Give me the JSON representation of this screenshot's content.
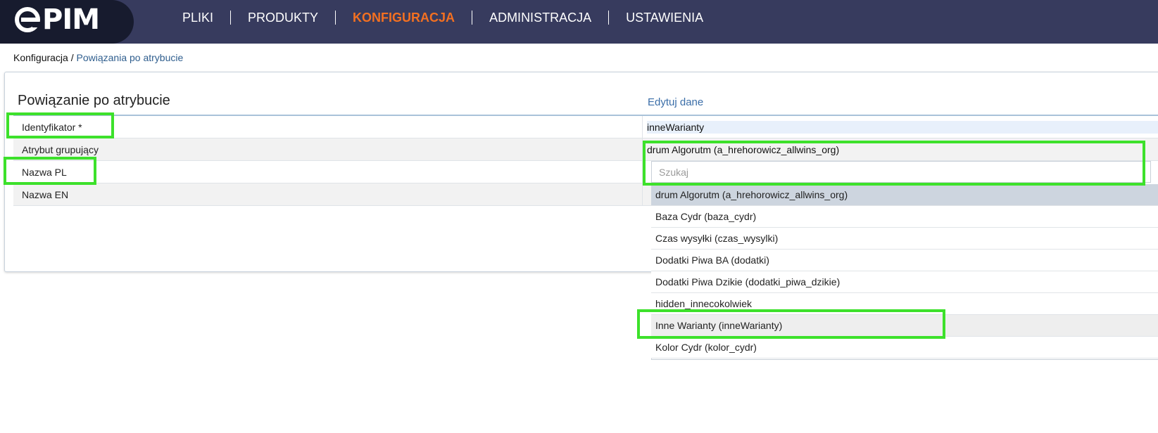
{
  "brand": {
    "logo_text": "PIM"
  },
  "nav": {
    "items": [
      {
        "label": "PLIKI",
        "active": false
      },
      {
        "label": "PRODUKTY",
        "active": false
      },
      {
        "label": "KONFIGURACJA",
        "active": true
      },
      {
        "label": "ADMINISTRACJA",
        "active": false
      },
      {
        "label": "USTAWIENIA",
        "active": false
      }
    ]
  },
  "breadcrumb": {
    "root": "Konfiguracja",
    "separator": " / ",
    "current": "Powiązania po atrybucie"
  },
  "panel": {
    "title": "Powiązanie po atrybucie",
    "edit_label": "Edytuj dane"
  },
  "form": {
    "rows": [
      {
        "label": "Identyfikator *",
        "value": "inneWarianty"
      },
      {
        "label": "Atrybut grupujący",
        "value": "drum Algorutm (a_hrehorowicz_allwins_org)"
      },
      {
        "label": "Nazwa PL",
        "value": ""
      },
      {
        "label": "Nazwa EN",
        "value": ""
      }
    ]
  },
  "dropdown": {
    "search_placeholder": "Szukaj",
    "options": [
      "drum Algorutm (a_hrehorowicz_allwins_org)",
      "Baza Cydr (baza_cydr)",
      "Czas wysyłki (czas_wysylki)",
      "Dodatki Piwa BA (dodatki)",
      "Dodatki Piwa Dzikie (dodatki_piwa_dzikie)",
      "hidden_innecokolwiek",
      "Inne Warianty (inneWarianty)",
      "Kolor Cydr (kolor_cydr)"
    ],
    "selected_index": 0,
    "hovered_index": 6
  },
  "colors": {
    "topbar": "#373b5e",
    "logo_bg": "#171b2e",
    "accent": "#f37021",
    "link": "#3b6ea8",
    "highlight": "#3de12b"
  }
}
